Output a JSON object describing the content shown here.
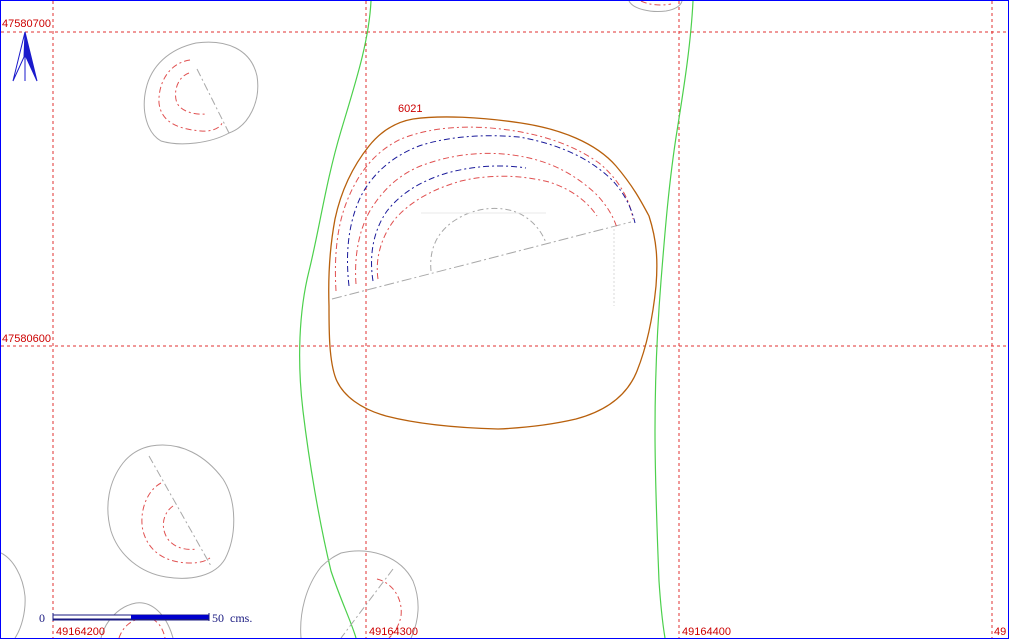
{
  "feature_label": "6021",
  "grid": {
    "y_labels": [
      "47580700",
      "47580600"
    ],
    "x_labels": [
      "49164200",
      "49164300",
      "49164400",
      "49"
    ]
  },
  "scale_bar": {
    "start_label": "0",
    "end_label": "50",
    "unit_label": "cms."
  },
  "north_arrow": {
    "icon": "north-arrow-icon"
  },
  "colors": {
    "grid": "#e03030",
    "contour_green": "#4cd04c",
    "feature_outline": "#b8600c",
    "contour_red": "#e05050",
    "contour_blue": "#1a1a9a",
    "contour_gray": "#a8a8a8",
    "frame": "#0000ff"
  }
}
